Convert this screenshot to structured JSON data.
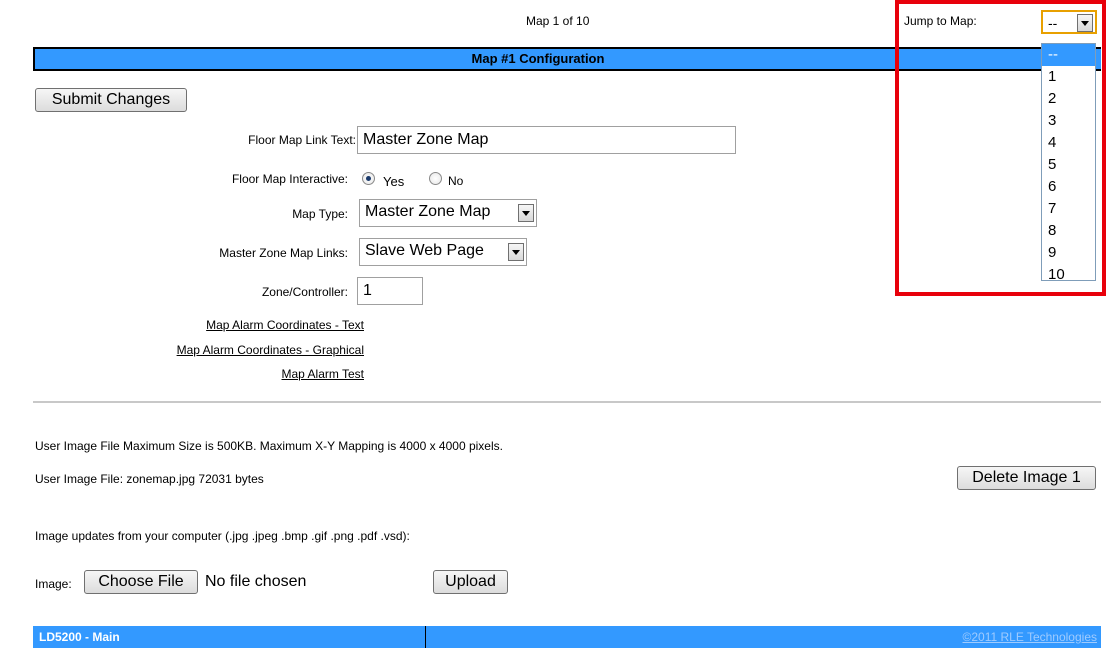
{
  "header": {
    "map_counter": "Map 1 of 10",
    "jump_label": "Jump to Map:",
    "jump_selected": "--"
  },
  "config_bar": {
    "title": "Map #1 Configuration"
  },
  "form": {
    "submit_label": "Submit Changes",
    "link_text_label": "Floor Map Link Text:",
    "link_text_value": "Master Zone Map",
    "interactive_label": "Floor Map Interactive:",
    "interactive_yes": "Yes",
    "interactive_no": "No",
    "map_type_label": "Map Type:",
    "map_type_value": "Master Zone Map",
    "links_label": "Master Zone Map Links:",
    "links_value": "Slave Web Page",
    "zone_label": "Zone/Controller:",
    "zone_value": "1",
    "link_coords_text": "Map Alarm Coordinates - Text",
    "link_coords_graphical": "Map Alarm Coordinates - Graphical",
    "link_alarm_test": "Map Alarm Test"
  },
  "image_section": {
    "max_size_note": "User Image File Maximum Size is 500KB. Maximum X-Y Mapping is 4000 x 4000 pixels.",
    "file_info": "User Image File: zonemap.jpg 72031 bytes",
    "delete_label": "Delete Image 1",
    "updates_note": "Image updates from your computer (.jpg .jpeg .bmp .gif .png .pdf .vsd):",
    "image_label": "Image:",
    "choose_label": "Choose File",
    "no_file": "No file chosen",
    "upload_label": "Upload"
  },
  "dropdown": {
    "options": [
      "--",
      "1",
      "2",
      "3",
      "4",
      "5",
      "6",
      "7",
      "8",
      "9",
      "10"
    ]
  },
  "footer": {
    "left": "LD5200 - Main",
    "right": "©2011 RLE Technologies"
  },
  "colors": {
    "bar_blue": "#3399ff",
    "highlight_red": "#e8000b"
  }
}
